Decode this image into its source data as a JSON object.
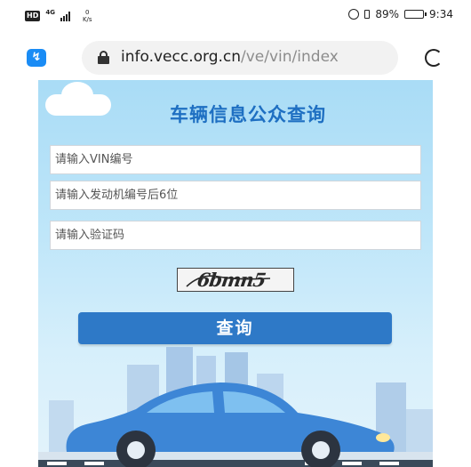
{
  "status_bar": {
    "hd": "HD",
    "network": "4G",
    "speed_value": "0",
    "speed_unit": "K/s",
    "battery": "89%",
    "time": "9:34",
    "battery_level": 0.89
  },
  "browser": {
    "url_domain": "info.vecc.org.cn",
    "url_path": "/ve/vin/index",
    "app_icon": "lightning-icon",
    "lock_icon": "lock-icon",
    "reload_icon": "reload-icon"
  },
  "page": {
    "title": "车辆信息公众查询",
    "vin_placeholder": "请输入VIN编号",
    "engine_placeholder": "请输入发动机编号后6位",
    "captcha_placeholder": "请输入验证码",
    "captcha_text": "6bmn5",
    "query_button": "查询"
  },
  "colors": {
    "accent": "#2e79c7",
    "title": "#1e6fc2",
    "background_top": "#a9dcf6",
    "car": "#3d86d6"
  }
}
